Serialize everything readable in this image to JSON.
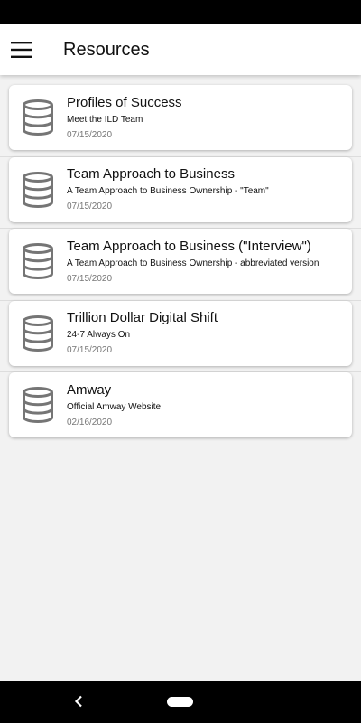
{
  "app_bar": {
    "title": "Resources",
    "menu_icon": "hamburger-menu-icon"
  },
  "resources": [
    {
      "title": "Profiles of Success",
      "subtitle": "Meet the ILD Team",
      "date": "07/15/2020",
      "icon": "database-icon"
    },
    {
      "title": "Team Approach to Business",
      "subtitle": "A Team Approach to Business Ownership - \"Team\"",
      "date": "07/15/2020",
      "icon": "database-icon"
    },
    {
      "title": "Team Approach to Business (\"Interview\")",
      "subtitle": "A Team Approach to Business Ownership - abbreviated version",
      "date": "07/15/2020",
      "icon": "database-icon"
    },
    {
      "title": "Trillion Dollar Digital Shift",
      "subtitle": "24-7 Always On",
      "date": "07/15/2020",
      "icon": "database-icon"
    },
    {
      "title": "Amway",
      "subtitle": "Official Amway Website",
      "date": "02/16/2020",
      "icon": "database-icon"
    }
  ],
  "nav_bar": {
    "back_icon": "back-chevron-icon",
    "home_icon": "home-pill-icon"
  },
  "colors": {
    "background": "#f2f2f2",
    "card": "#ffffff",
    "icon": "#757575",
    "system_bars": "#000000"
  }
}
